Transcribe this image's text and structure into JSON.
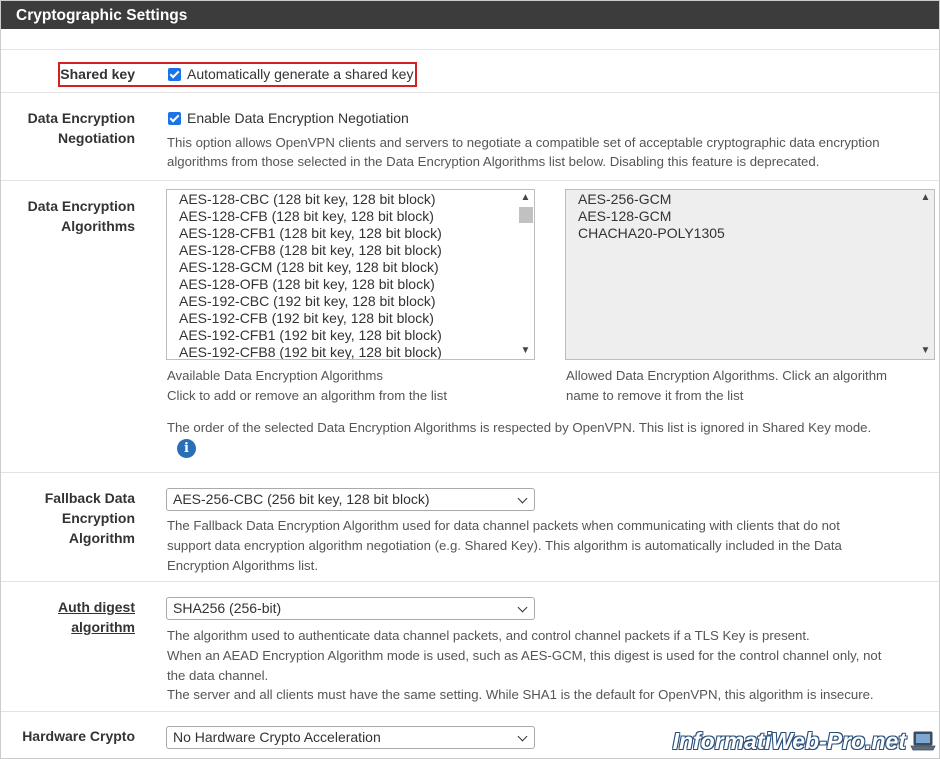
{
  "panel": {
    "title": "Cryptographic Settings"
  },
  "shared_key": {
    "label": "Shared key",
    "checkbox_label": "Automatically generate a shared key",
    "checked": true
  },
  "data_encryption_negotiation": {
    "label_line1": "Data Encryption",
    "label_line2": "Negotiation",
    "checkbox_label": "Enable Data Encryption Negotiation",
    "checked": true,
    "help_line1": "This option allows OpenVPN clients and servers to negotiate a compatible set of acceptable cryptographic data encryption",
    "help_line2": "algorithms from those selected in the Data Encryption Algorithms list below. Disabling this feature is deprecated."
  },
  "data_encryption_algorithms": {
    "label_line1": "Data Encryption",
    "label_line2": "Algorithms",
    "available": [
      "AES-128-CBC (128 bit key, 128 bit block)",
      "AES-128-CFB (128 bit key, 128 bit block)",
      "AES-128-CFB1 (128 bit key, 128 bit block)",
      "AES-128-CFB8 (128 bit key, 128 bit block)",
      "AES-128-GCM (128 bit key, 128 bit block)",
      "AES-128-OFB (128 bit key, 128 bit block)",
      "AES-192-CBC (192 bit key, 128 bit block)",
      "AES-192-CFB (192 bit key, 128 bit block)",
      "AES-192-CFB1 (192 bit key, 128 bit block)",
      "AES-192-CFB8 (192 bit key, 128 bit block)"
    ],
    "allowed": [
      "AES-256-GCM",
      "AES-128-GCM",
      "CHACHA20-POLY1305"
    ],
    "available_help_line1": "Available Data Encryption Algorithms",
    "available_help_line2": "Click to add or remove an algorithm from the list",
    "allowed_help_line1": "Allowed Data Encryption Algorithms. Click an algorithm",
    "allowed_help_line2": "name to remove it from the list",
    "order_note": "The order of the selected Data Encryption Algorithms is respected by OpenVPN. This list is ignored in Shared Key mode.",
    "info_icon": "i"
  },
  "fallback": {
    "label_line1": "Fallback Data",
    "label_line2": "Encryption",
    "label_line3": "Algorithm",
    "selected": "AES-256-CBC (256 bit key, 128 bit block)",
    "help_line1": "The Fallback Data Encryption Algorithm used for data channel packets when communicating with clients that do not",
    "help_line2": "support data encryption algorithm negotiation (e.g. Shared Key). This algorithm is automatically included in the Data",
    "help_line3": "Encryption Algorithms list."
  },
  "auth_digest": {
    "label_line1": "Auth digest",
    "label_line2": "algorithm",
    "selected": "SHA256 (256-bit)",
    "help_line1": "The algorithm used to authenticate data channel packets, and control channel packets if a TLS Key is present.",
    "help_line2": "When an AEAD Encryption Algorithm mode is used, such as AES-GCM, this digest is used for the control channel only, not",
    "help_line3": "the data channel.",
    "help_line4": "The server and all clients must have the same setting. While SHA1 is the default for OpenVPN, this algorithm is insecure."
  },
  "hardware_crypto": {
    "label": "Hardware Crypto",
    "selected": "No Hardware Crypto Acceleration"
  },
  "watermark": {
    "text": "InformatiWeb-Pro.net"
  },
  "colors": {
    "header_bg": "#3c3c3c",
    "checkbox": "#1a73e8",
    "highlight_border": "#d32121",
    "info_icon": "#2a6fb5"
  }
}
